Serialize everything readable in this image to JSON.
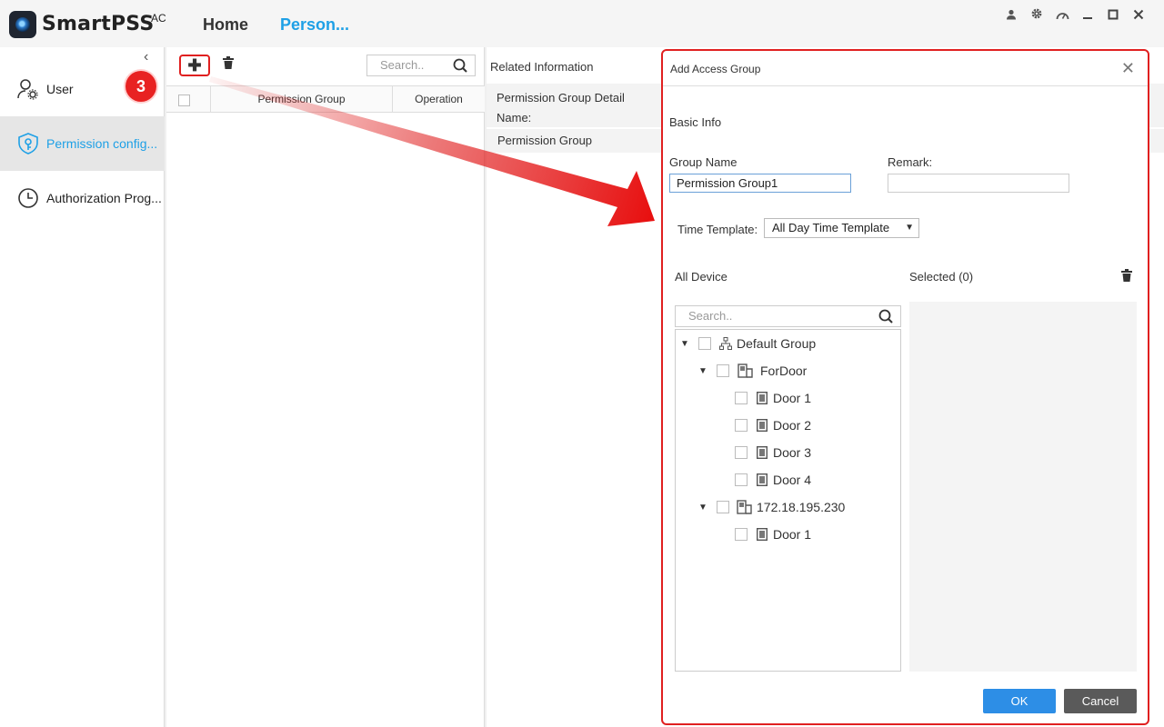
{
  "app": {
    "name": "SmartPSS",
    "superscript": "AC",
    "tabs": [
      "Home",
      "Person..."
    ],
    "icons": [
      "user-icon",
      "gear-icon",
      "dashboard-icon",
      "minimize-icon",
      "maximize-icon",
      "close-icon"
    ]
  },
  "sidebar": {
    "items": [
      {
        "label": "User",
        "icon": "user-settings-icon"
      },
      {
        "label": "Permission config...",
        "icon": "shield-key-icon"
      },
      {
        "label": "Authorization Prog...",
        "icon": "clock-icon"
      }
    ],
    "step_badge": "3"
  },
  "list": {
    "search_placeholder": "Search..",
    "columns": [
      "Permission Group",
      "Operation"
    ]
  },
  "related": {
    "title": "Related Information",
    "detail_line1": "Permission Group Detail",
    "detail_line2": "Name:",
    "group_label": "Permission Group"
  },
  "dialog": {
    "title": "Add Access Group",
    "basic_info": "Basic Info",
    "group_name_label": "Group Name",
    "group_name_value": "Permission Group1",
    "remark_label": "Remark:",
    "remark_value": "",
    "time_template_label": "Time Template:",
    "time_template_value": "All Day Time Template",
    "all_device_label": "All Device",
    "selected_label": "Selected (0)",
    "device_search_placeholder": "Search..",
    "tree": [
      {
        "label": "Default Group",
        "type": "group"
      },
      {
        "label": "ForDoor",
        "type": "device"
      },
      {
        "label": "Door 1",
        "type": "door"
      },
      {
        "label": "Door 2",
        "type": "door"
      },
      {
        "label": "Door 3",
        "type": "door"
      },
      {
        "label": "Door 4",
        "type": "door"
      },
      {
        "label": "172.18.195.230",
        "type": "device"
      },
      {
        "label": "Door 1",
        "type": "door"
      }
    ],
    "ok_label": "OK",
    "cancel_label": "Cancel"
  },
  "colors": {
    "accent": "#1ea0e6",
    "annotation_red": "#e02020",
    "ok_button": "#2d8ee6",
    "cancel_button": "#5a5a5a"
  }
}
